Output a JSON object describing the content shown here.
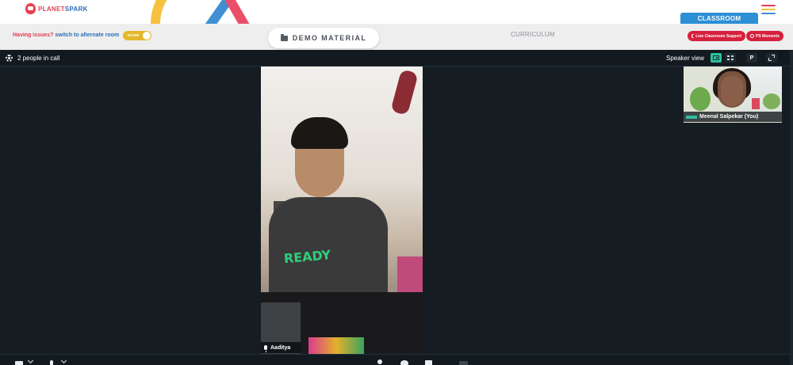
{
  "brand": {
    "name_part1": "PLANET",
    "name_part2": "SPARK"
  },
  "header": {
    "classroom_tab": "CLASSROOM",
    "menu_colors": [
      "#e8414f",
      "#f6c23e",
      "#3f8fd2"
    ]
  },
  "subheader": {
    "issues_question": "Having issues?",
    "issues_link": "switch to alternate room",
    "room_toggle_label": "ROOM",
    "demo_material": "DEMO MATERIAL",
    "curriculum": "CURRICULUM",
    "live_support": "Live Classroom Support",
    "ps_moments": "PS Moments"
  },
  "call": {
    "people_count": "2 people in call",
    "view_mode": "Speaker view",
    "p_button": "P"
  },
  "participants": {
    "main": {
      "name": "Aaditya",
      "shirt_text": "READY"
    },
    "self": {
      "name": "Meenal Salpekar (You)"
    }
  },
  "colors": {
    "accent_red": "#d6203c",
    "accent_blue": "#2d8fd5",
    "accent_teal": "#2fc0a0",
    "toggle_yellow": "#e5b82c",
    "call_bg": "#151c22"
  },
  "icons": {
    "settings": "gear-icon",
    "speaker_view": "speaker-view-icon",
    "grid_view": "grid-view-icon",
    "fullscreen": "expand-icon",
    "mic": "mic-icon",
    "camera": "camera-icon",
    "folder": "folder-icon",
    "menu": "hamburger-menu-icon"
  }
}
